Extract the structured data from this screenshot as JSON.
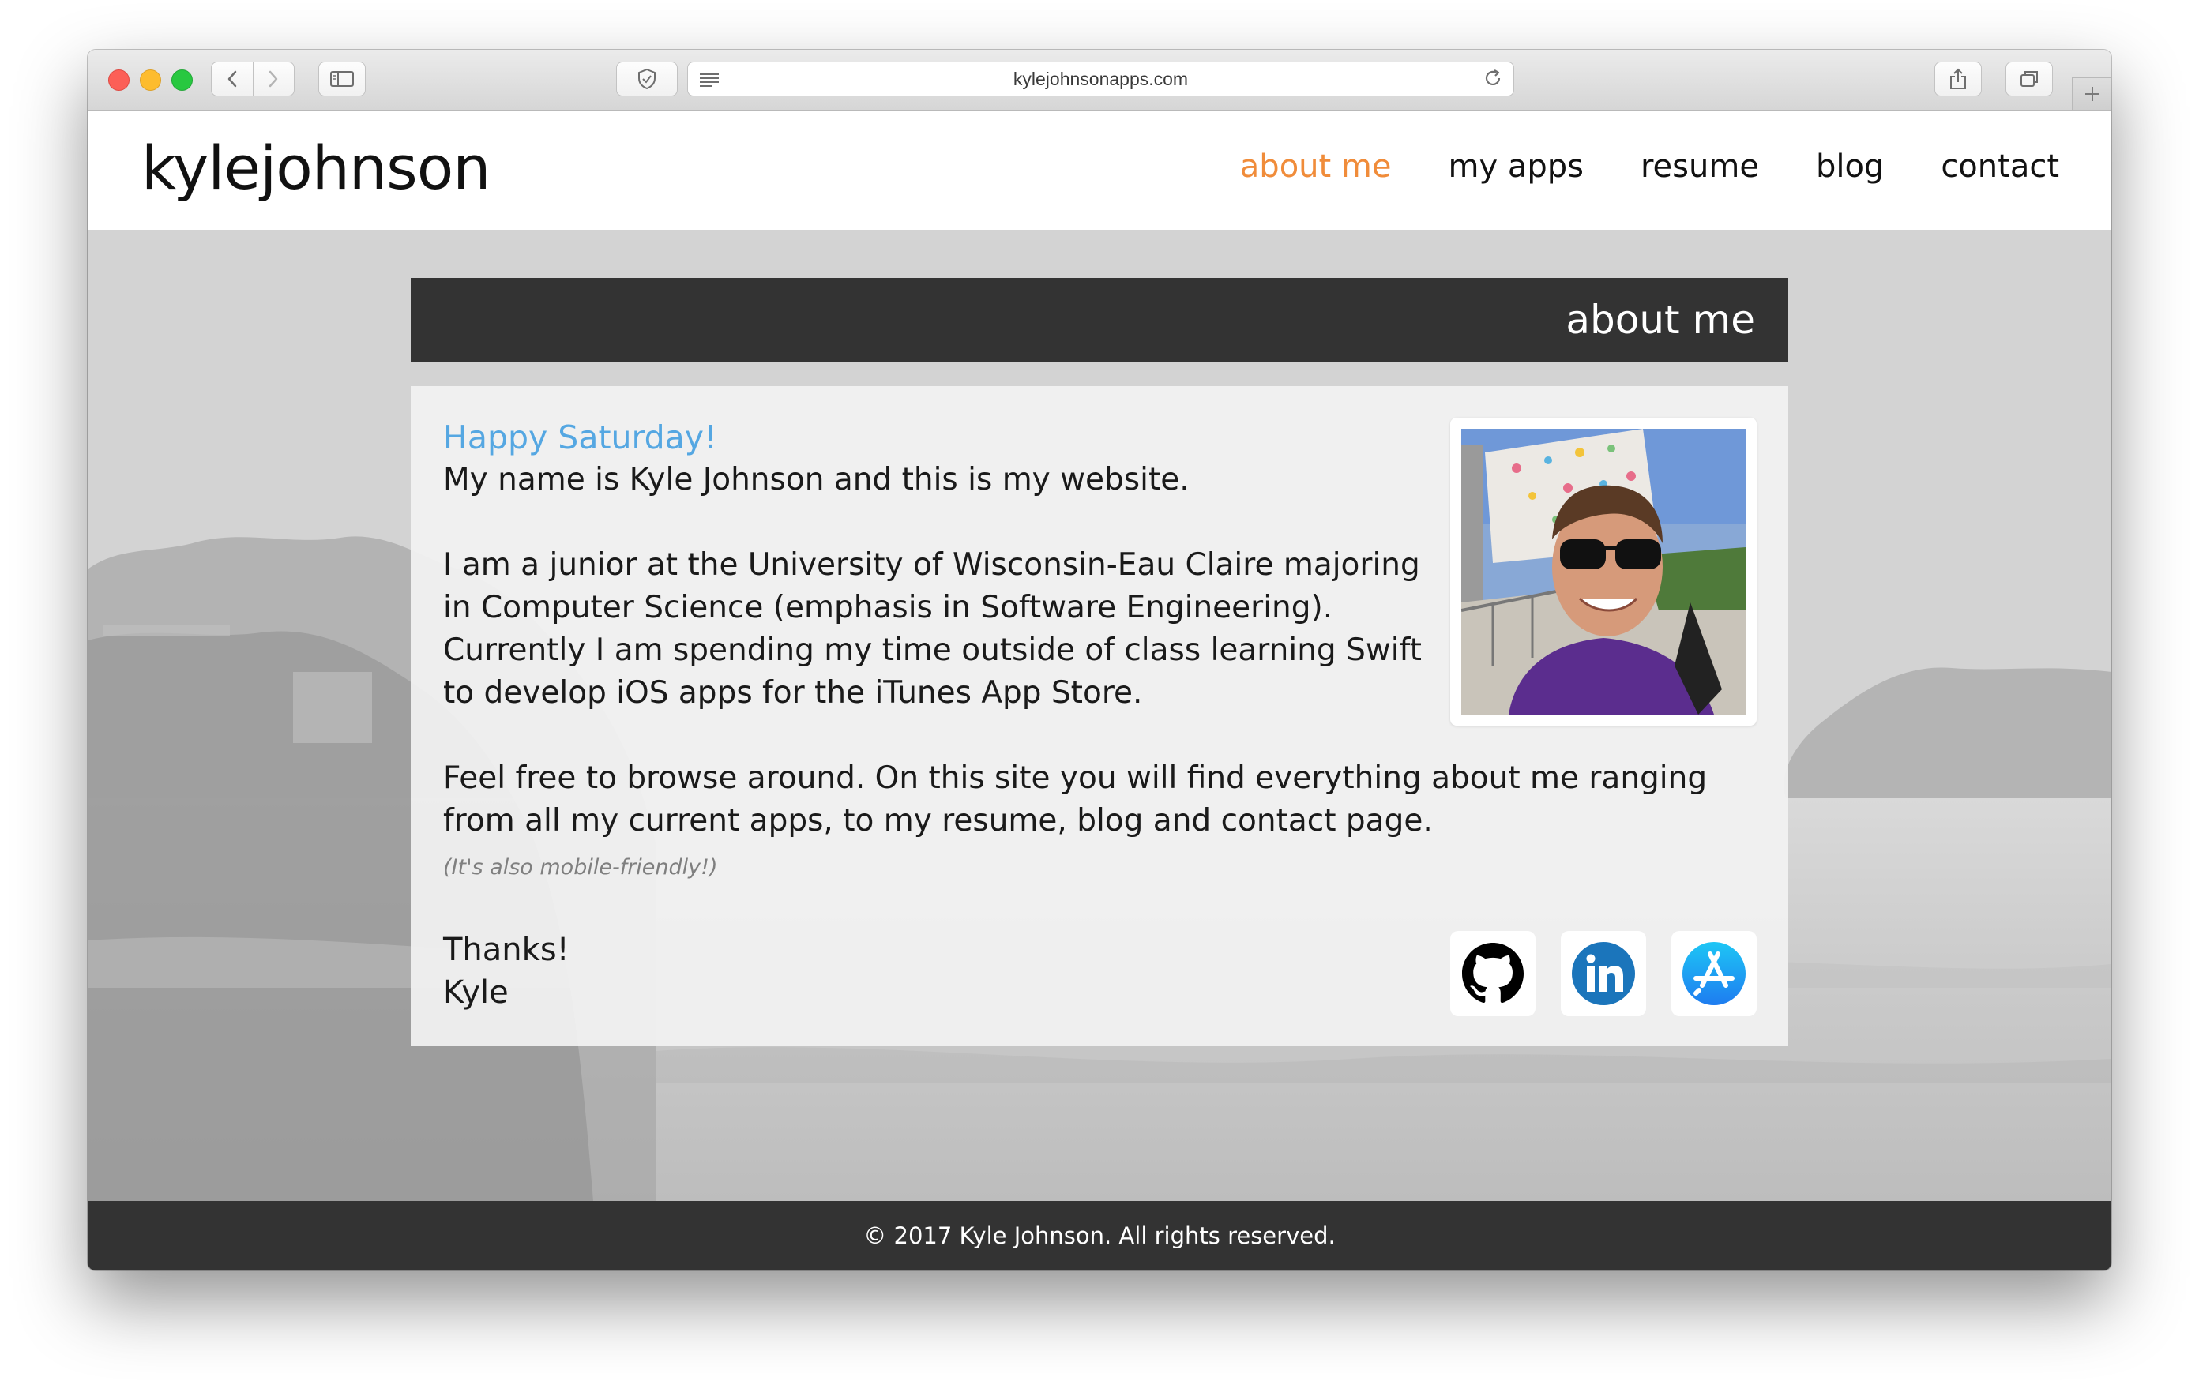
{
  "browser": {
    "url": "kylejohnsonapps.com",
    "icons": {
      "back": "chevron-left-icon",
      "forward": "chevron-right-icon",
      "sidebar": "sidebar-icon",
      "privacy": "shield-icon",
      "reader": "reader-icon",
      "reload": "reload-icon",
      "share": "share-icon",
      "tabs": "tabs-icon",
      "new_tab": "plus-icon"
    }
  },
  "site": {
    "logo": "kylejohnson",
    "nav": [
      {
        "label": "about me",
        "active": true
      },
      {
        "label": "my apps",
        "active": false
      },
      {
        "label": "resume",
        "active": false
      },
      {
        "label": "blog",
        "active": false
      },
      {
        "label": "contact",
        "active": false
      }
    ],
    "colors": {
      "accent": "#f08c3a",
      "greeting": "#55a7e2",
      "dark_bar": "#333333",
      "linkedin": "#1b75bb",
      "appstore": "#1e96f0"
    }
  },
  "about": {
    "title": "about me",
    "greeting": "Happy Saturday!",
    "paragraph1": "My name is Kyle Johnson and this is my website.",
    "paragraph2": "I am a junior at the University of Wisconsin-Eau Claire majoring in Computer Science (emphasis in Software Engineering). Currently I am spending my time outside of class learning Swift to develop iOS apps for the iTunes App Store.",
    "paragraph3": "Feel free to browse around. On this site you will find everything about me ranging from all my current apps, to my resume, blog and contact page.",
    "note": "(It's also mobile-friendly!)",
    "thanks": "Thanks!",
    "signature": "Kyle",
    "social": [
      {
        "name": "github",
        "icon": "github-icon"
      },
      {
        "name": "linkedin",
        "icon": "linkedin-icon"
      },
      {
        "name": "appstore",
        "icon": "app-store-icon"
      }
    ]
  },
  "footer": {
    "text": "© 2017 Kyle Johnson. All rights reserved."
  }
}
